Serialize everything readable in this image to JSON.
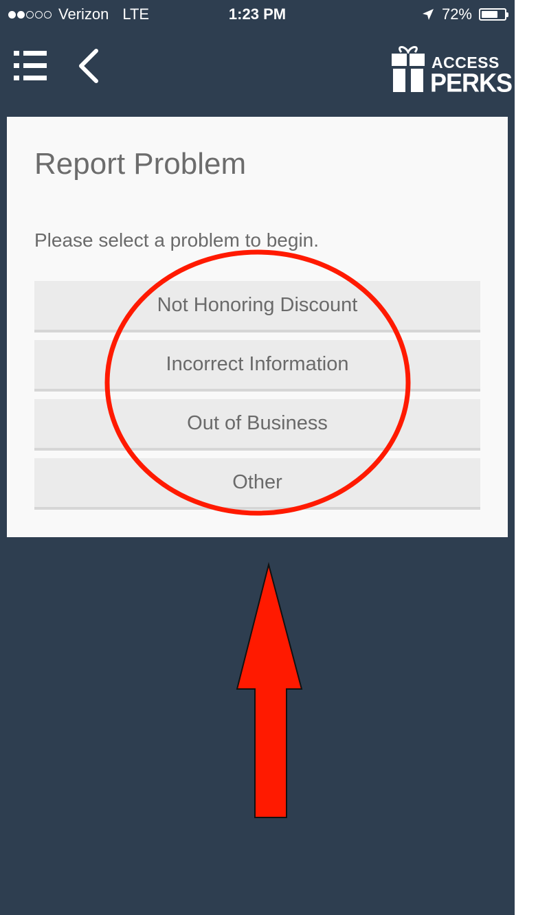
{
  "status_bar": {
    "carrier": "Verizon",
    "network": "LTE",
    "time": "1:23 PM",
    "battery_percent": "72%",
    "signal_bars_filled": 2,
    "signal_bars_total": 5
  },
  "nav": {
    "menu_icon": "list-menu-icon",
    "back_icon": "chevron-left-icon",
    "logo_line1": "ACCESS",
    "logo_line2": "PERKS"
  },
  "card": {
    "title": "Report Problem",
    "instruction": "Please select a problem to begin.",
    "options": [
      {
        "label": "Not Honoring Discount"
      },
      {
        "label": "Incorrect Information"
      },
      {
        "label": "Out of Business"
      },
      {
        "label": "Other"
      }
    ]
  },
  "colors": {
    "background": "#2e3e50",
    "card": "#f9f9f9",
    "option": "#ebebeb",
    "annotation": "#ff1a00"
  }
}
